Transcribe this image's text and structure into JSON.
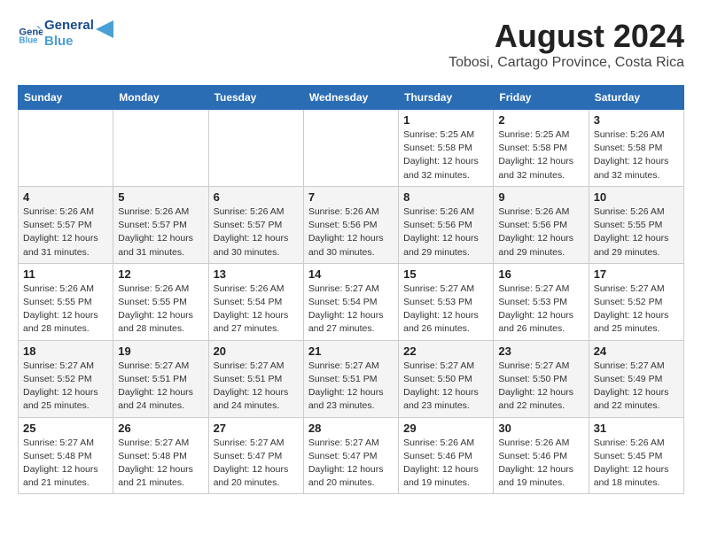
{
  "header": {
    "logo_line1": "General",
    "logo_line2": "Blue",
    "month_year": "August 2024",
    "location": "Tobosi, Cartago Province, Costa Rica"
  },
  "days_of_week": [
    "Sunday",
    "Monday",
    "Tuesday",
    "Wednesday",
    "Thursday",
    "Friday",
    "Saturday"
  ],
  "weeks": [
    [
      {
        "day": "",
        "info": ""
      },
      {
        "day": "",
        "info": ""
      },
      {
        "day": "",
        "info": ""
      },
      {
        "day": "",
        "info": ""
      },
      {
        "day": "1",
        "info": "Sunrise: 5:25 AM\nSunset: 5:58 PM\nDaylight: 12 hours\nand 32 minutes."
      },
      {
        "day": "2",
        "info": "Sunrise: 5:25 AM\nSunset: 5:58 PM\nDaylight: 12 hours\nand 32 minutes."
      },
      {
        "day": "3",
        "info": "Sunrise: 5:26 AM\nSunset: 5:58 PM\nDaylight: 12 hours\nand 32 minutes."
      }
    ],
    [
      {
        "day": "4",
        "info": "Sunrise: 5:26 AM\nSunset: 5:57 PM\nDaylight: 12 hours\nand 31 minutes."
      },
      {
        "day": "5",
        "info": "Sunrise: 5:26 AM\nSunset: 5:57 PM\nDaylight: 12 hours\nand 31 minutes."
      },
      {
        "day": "6",
        "info": "Sunrise: 5:26 AM\nSunset: 5:57 PM\nDaylight: 12 hours\nand 30 minutes."
      },
      {
        "day": "7",
        "info": "Sunrise: 5:26 AM\nSunset: 5:56 PM\nDaylight: 12 hours\nand 30 minutes."
      },
      {
        "day": "8",
        "info": "Sunrise: 5:26 AM\nSunset: 5:56 PM\nDaylight: 12 hours\nand 29 minutes."
      },
      {
        "day": "9",
        "info": "Sunrise: 5:26 AM\nSunset: 5:56 PM\nDaylight: 12 hours\nand 29 minutes."
      },
      {
        "day": "10",
        "info": "Sunrise: 5:26 AM\nSunset: 5:55 PM\nDaylight: 12 hours\nand 29 minutes."
      }
    ],
    [
      {
        "day": "11",
        "info": "Sunrise: 5:26 AM\nSunset: 5:55 PM\nDaylight: 12 hours\nand 28 minutes."
      },
      {
        "day": "12",
        "info": "Sunrise: 5:26 AM\nSunset: 5:55 PM\nDaylight: 12 hours\nand 28 minutes."
      },
      {
        "day": "13",
        "info": "Sunrise: 5:26 AM\nSunset: 5:54 PM\nDaylight: 12 hours\nand 27 minutes."
      },
      {
        "day": "14",
        "info": "Sunrise: 5:27 AM\nSunset: 5:54 PM\nDaylight: 12 hours\nand 27 minutes."
      },
      {
        "day": "15",
        "info": "Sunrise: 5:27 AM\nSunset: 5:53 PM\nDaylight: 12 hours\nand 26 minutes."
      },
      {
        "day": "16",
        "info": "Sunrise: 5:27 AM\nSunset: 5:53 PM\nDaylight: 12 hours\nand 26 minutes."
      },
      {
        "day": "17",
        "info": "Sunrise: 5:27 AM\nSunset: 5:52 PM\nDaylight: 12 hours\nand 25 minutes."
      }
    ],
    [
      {
        "day": "18",
        "info": "Sunrise: 5:27 AM\nSunset: 5:52 PM\nDaylight: 12 hours\nand 25 minutes."
      },
      {
        "day": "19",
        "info": "Sunrise: 5:27 AM\nSunset: 5:51 PM\nDaylight: 12 hours\nand 24 minutes."
      },
      {
        "day": "20",
        "info": "Sunrise: 5:27 AM\nSunset: 5:51 PM\nDaylight: 12 hours\nand 24 minutes."
      },
      {
        "day": "21",
        "info": "Sunrise: 5:27 AM\nSunset: 5:51 PM\nDaylight: 12 hours\nand 23 minutes."
      },
      {
        "day": "22",
        "info": "Sunrise: 5:27 AM\nSunset: 5:50 PM\nDaylight: 12 hours\nand 23 minutes."
      },
      {
        "day": "23",
        "info": "Sunrise: 5:27 AM\nSunset: 5:50 PM\nDaylight: 12 hours\nand 22 minutes."
      },
      {
        "day": "24",
        "info": "Sunrise: 5:27 AM\nSunset: 5:49 PM\nDaylight: 12 hours\nand 22 minutes."
      }
    ],
    [
      {
        "day": "25",
        "info": "Sunrise: 5:27 AM\nSunset: 5:48 PM\nDaylight: 12 hours\nand 21 minutes."
      },
      {
        "day": "26",
        "info": "Sunrise: 5:27 AM\nSunset: 5:48 PM\nDaylight: 12 hours\nand 21 minutes."
      },
      {
        "day": "27",
        "info": "Sunrise: 5:27 AM\nSunset: 5:47 PM\nDaylight: 12 hours\nand 20 minutes."
      },
      {
        "day": "28",
        "info": "Sunrise: 5:27 AM\nSunset: 5:47 PM\nDaylight: 12 hours\nand 20 minutes."
      },
      {
        "day": "29",
        "info": "Sunrise: 5:26 AM\nSunset: 5:46 PM\nDaylight: 12 hours\nand 19 minutes."
      },
      {
        "day": "30",
        "info": "Sunrise: 5:26 AM\nSunset: 5:46 PM\nDaylight: 12 hours\nand 19 minutes."
      },
      {
        "day": "31",
        "info": "Sunrise: 5:26 AM\nSunset: 5:45 PM\nDaylight: 12 hours\nand 18 minutes."
      }
    ]
  ]
}
